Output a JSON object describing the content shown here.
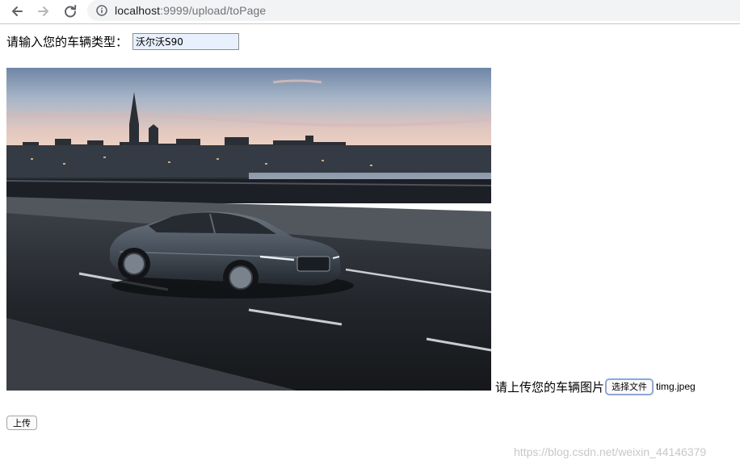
{
  "browser": {
    "url_host": "localhost",
    "url_rest": ":9999/upload/toPage"
  },
  "form": {
    "type_label": "请输入您的车辆类型：",
    "type_value": "沃尔沃S90",
    "image_label": "请上传您的车辆图片",
    "file_button_label": "选择文件",
    "file_name": "timg.jpeg",
    "upload_button_label": "上传"
  },
  "watermark": "https://blog.csdn.net/weixin_44146379",
  "colors": {
    "input_autofill_bg": "#e8f0fe",
    "focus_ring": "#7fa5e8",
    "omnibox_bg": "#f1f3f4"
  }
}
